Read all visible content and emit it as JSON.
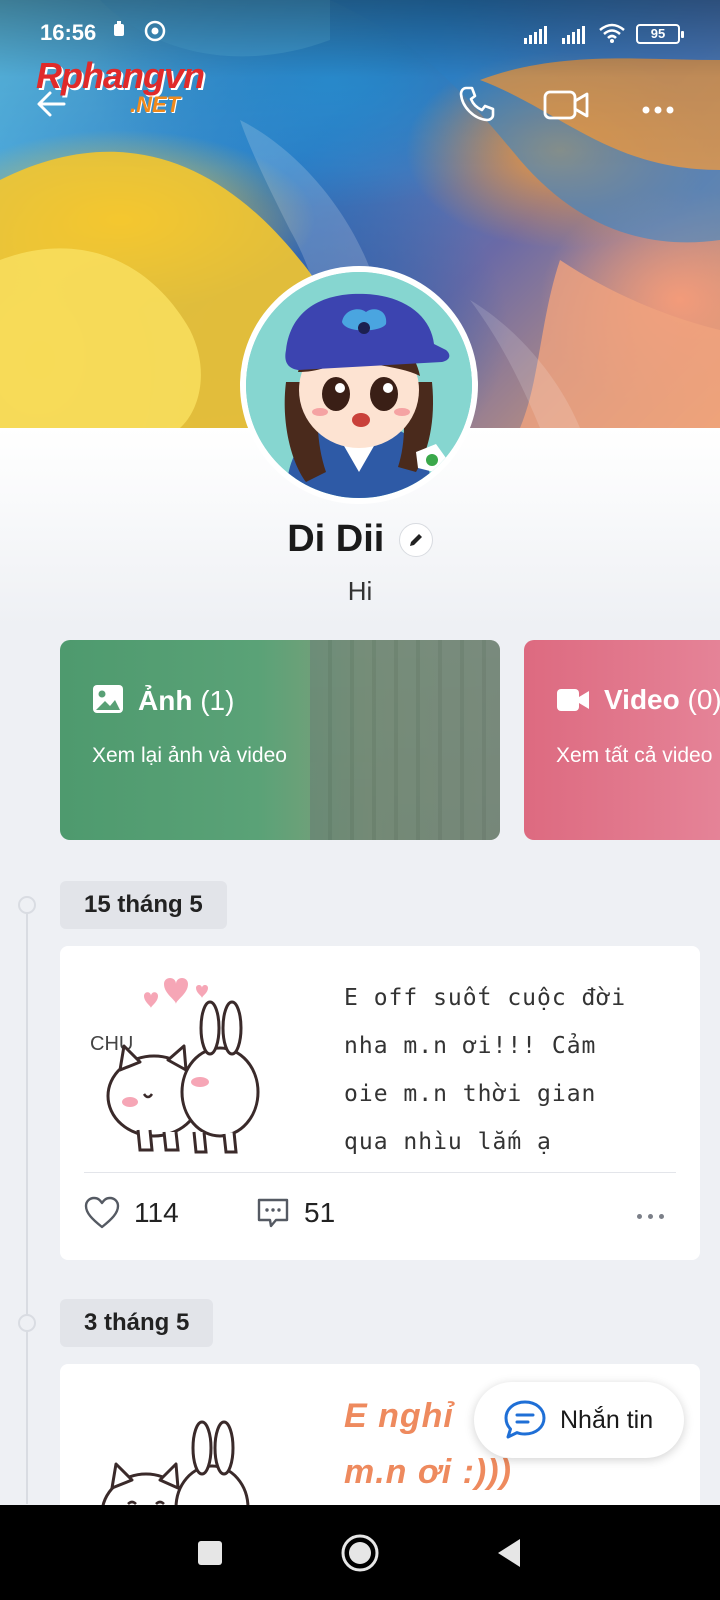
{
  "status_bar": {
    "time": "16:56",
    "battery": "95"
  },
  "watermark": {
    "line1": "Rphangvn",
    "line2": ".NET"
  },
  "profile": {
    "name": "Di Dii",
    "bio": "Hi"
  },
  "media_cards": [
    {
      "title": "Ảnh",
      "count": "(1)",
      "subtitle": "Xem lại ảnh và video"
    },
    {
      "title": "Video",
      "count": "(0)",
      "subtitle": "Xem tất cả video"
    }
  ],
  "posts": [
    {
      "date": "15 tháng 5",
      "text_lines": [
        "E off suốt cuộc đời",
        "nha m.n ơi!!! Cảm",
        "oie m.n thời gian",
        "qua nhìu lắm ạ"
      ],
      "sticker_text": "CHU",
      "likes": "114",
      "comments": "51"
    },
    {
      "date": "3 tháng 5",
      "text_lines": [
        "E nghỉ",
        "m.n ơi :)))"
      ]
    }
  ],
  "fab": {
    "label": "Nhắn tin"
  },
  "icons": {
    "back": "back-arrow-icon",
    "call": "phone-icon",
    "video_call": "video-camera-icon",
    "more": "more-dots-icon",
    "edit": "pencil-icon",
    "photo": "image-icon",
    "video": "video-icon",
    "like": "heart-icon",
    "comment": "comment-icon",
    "message": "chat-bubble-icon"
  },
  "colors": {
    "photo_card": "#4e9a6e",
    "video_card": "#dd6a80",
    "accent_blue": "#1f6fd6",
    "post_text_orange": "#ee8a5e"
  }
}
